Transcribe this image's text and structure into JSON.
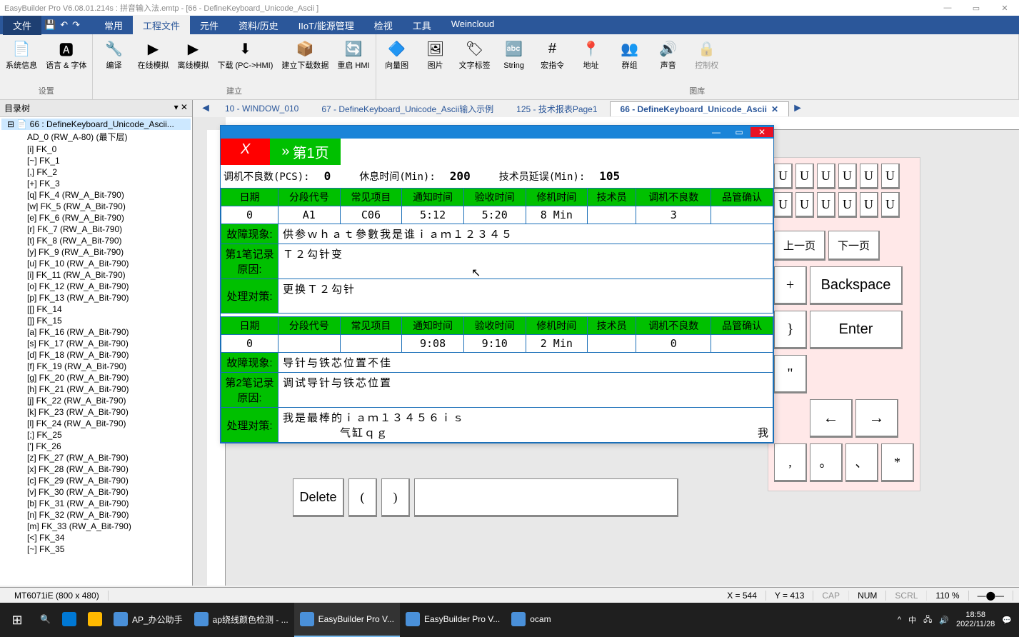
{
  "title": "EasyBuilder Pro V6.08.01.214s : 拼音输入法.emtp - [66 - DefineKeyboard_Unicode_Ascii ]",
  "menubar": {
    "file": "文件",
    "tabs": [
      "常用",
      "工程文件",
      "元件",
      "资料/历史",
      "IIoT/能源管理",
      "检视",
      "工具",
      "Weincloud"
    ],
    "active": 1
  },
  "ribbon": {
    "groups": {
      "settings": {
        "label": "设置",
        "items": [
          {
            "l": "系统信息"
          },
          {
            "l": "语言 & 字体"
          }
        ]
      },
      "build": {
        "label": "建立",
        "items": [
          {
            "l": "编译"
          },
          {
            "l": "在线模拟"
          },
          {
            "l": "离线模拟"
          },
          {
            "l": "下载 (PC->HMI)"
          },
          {
            "l": "建立下载数据"
          },
          {
            "l": "重启 HMI"
          }
        ]
      },
      "lib": {
        "label": "图库",
        "items": [
          {
            "l": "向量图"
          },
          {
            "l": "图片"
          },
          {
            "l": "文字标签"
          },
          {
            "l": "String"
          },
          {
            "l": "宏指令"
          },
          {
            "l": "地址"
          },
          {
            "l": "群组"
          },
          {
            "l": "声音"
          },
          {
            "l": "控制权",
            "disabled": true
          }
        ]
      }
    }
  },
  "tree": {
    "header": "目录树",
    "root": "66 : DefineKeyboard_Unicode_Ascii...",
    "items": [
      "AD_0 (RW_A-80) (最下层)",
      "[i] FK_0",
      "[~] FK_1",
      "[,] FK_2",
      "[+] FK_3",
      "[q] FK_4 (RW_A_Bit-790)",
      "[w] FK_5 (RW_A_Bit-790)",
      "[e] FK_6 (RW_A_Bit-790)",
      "[r] FK_7 (RW_A_Bit-790)",
      "[t] FK_8 (RW_A_Bit-790)",
      "[y] FK_9 (RW_A_Bit-790)",
      "[u] FK_10 (RW_A_Bit-790)",
      "[i] FK_11 (RW_A_Bit-790)",
      "[o] FK_12 (RW_A_Bit-790)",
      "[p] FK_13 (RW_A_Bit-790)",
      "[[] FK_14",
      "[]] FK_15",
      "[a] FK_16 (RW_A_Bit-790)",
      "[s] FK_17 (RW_A_Bit-790)",
      "[d] FK_18 (RW_A_Bit-790)",
      "[f] FK_19 (RW_A_Bit-790)",
      "[g] FK_20 (RW_A_Bit-790)",
      "[h] FK_21 (RW_A_Bit-790)",
      "[j] FK_22 (RW_A_Bit-790)",
      "[k] FK_23 (RW_A_Bit-790)",
      "[l] FK_24 (RW_A_Bit-790)",
      "[;] FK_25",
      "['] FK_26",
      "[z] FK_27 (RW_A_Bit-790)",
      "[x] FK_28 (RW_A_Bit-790)",
      "[c] FK_29 (RW_A_Bit-790)",
      "[v] FK_30 (RW_A_Bit-790)",
      "[b] FK_31 (RW_A_Bit-790)",
      "[n] FK_32 (RW_A_Bit-790)",
      "[m] FK_33 (RW_A_Bit-790)",
      "[<] FK_34",
      "[~] FK_35"
    ]
  },
  "doctabs": [
    {
      "l": "10 - WINDOW_010"
    },
    {
      "l": "67 - DefineKeyboard_Unicode_Ascii输入示例"
    },
    {
      "l": "125 - 技术报表Page1"
    },
    {
      "l": "66 - DefineKeyboard_Unicode_Ascii",
      "active": true,
      "close": true
    }
  ],
  "win": {
    "x_btn": "X",
    "page_btn": "第1页",
    "info": {
      "l1": "调机不良数(PCS):",
      "v1": "0",
      "l2": "休息时间(Min):",
      "v2": "200",
      "l3": "技术员延误(Min):",
      "v3": "105"
    },
    "headers": [
      "日期",
      "分段代号",
      "常见项目",
      "通知时间",
      "验收时间",
      "修机时间",
      "技术员",
      "调机不良数",
      "品管确认"
    ],
    "rec1": {
      "row": [
        "0",
        "A1",
        "C06",
        "5:12",
        "5:20",
        "8  Min",
        "",
        "3",
        ""
      ],
      "fault_l": "故障现象:",
      "fault": "供参ｗｈａｔ參數我是谁ｉａｍ１２３４５",
      "note_l": "第1笔记录",
      "cause_l": "原因:",
      "cause": "Ｔ２勾针变",
      "action_l": "处理对策:",
      "action": "更换Ｔ２勾针"
    },
    "rec2": {
      "row": [
        "0",
        "",
        "",
        "9:08",
        "9:10",
        "2  Min",
        "",
        "0",
        ""
      ],
      "fault_l": "故障现象:",
      "fault": "导针与铁芯位置不佳",
      "note_l": "第2笔记录",
      "cause_l": "原因:",
      "cause": "调试导针与铁芯位置",
      "action_l": "处理对策:",
      "action": "我是最棒的ｉａｍ１３４５６ｉｓ",
      "action2": "气缸ｑｇ",
      "tail": "我"
    }
  },
  "keyboard": {
    "u_row": [
      "U",
      "U",
      "U",
      "U",
      "U",
      "U"
    ],
    "prev": "上一页",
    "next": "下一页",
    "plus": "+",
    "backspace": "Backspace",
    "brace": "}",
    "enter": "Enter",
    "quote": "\"",
    "left": "←",
    "right": "→",
    "delete": "Delete",
    "lp": "(",
    "rp": ")",
    "comma": ",",
    "period": "。",
    "dun": "、",
    "star": "*"
  },
  "status": {
    "model": "MT6071iE (800 x 480)",
    "x": "X = 544",
    "y": "Y = 413",
    "cap": "CAP",
    "num": "NUM",
    "scrl": "SCRL",
    "zoom": "110 %"
  },
  "taskbar": {
    "items": [
      {
        "l": "AP_办公助手"
      },
      {
        "l": "ap绕线颜色检测 - ..."
      },
      {
        "l": "EasyBuilder Pro V...",
        "active": true
      },
      {
        "l": "EasyBuilder Pro V..."
      },
      {
        "l": "ocam"
      }
    ],
    "time": "18:58",
    "date": "2022/11/28"
  }
}
